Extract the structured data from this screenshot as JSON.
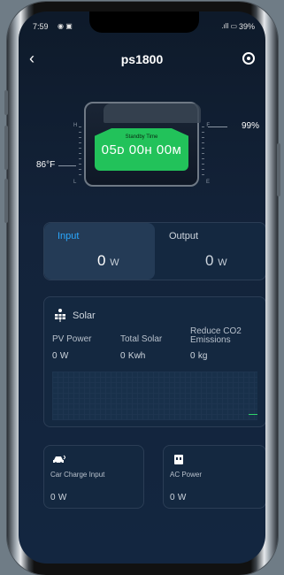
{
  "status": {
    "time": "7:59",
    "battery": "39%"
  },
  "header": {
    "title": "ps1800"
  },
  "device": {
    "standby_label": "Standby Time",
    "standby_time": "05ᴅ 00ʜ 00ᴍ",
    "temperature": "86°F",
    "battery_percent": "99%",
    "gauge_left_top": "H",
    "gauge_left_bottom": "L",
    "gauge_right_top": "F",
    "gauge_right_bottom": "E"
  },
  "power": {
    "input_label": "Input",
    "input_value": "0",
    "input_unit": "W",
    "output_label": "Output",
    "output_value": "0",
    "output_unit": "W"
  },
  "solar": {
    "title": "Solar",
    "pv_label": "PV Power",
    "pv_value": "0",
    "pv_unit": "W",
    "total_label": "Total Solar",
    "total_value": "0",
    "total_unit": "Kwh",
    "co2_label": "Reduce CO2 Emissions",
    "co2_value": "0",
    "co2_unit": "kg"
  },
  "car": {
    "label": "Car Charge Input",
    "value": "0",
    "unit": "W"
  },
  "ac": {
    "label": "AC Power",
    "value": "0",
    "unit": "W"
  },
  "colors": {
    "accent": "#2aa8ff",
    "green": "#22c25a"
  }
}
